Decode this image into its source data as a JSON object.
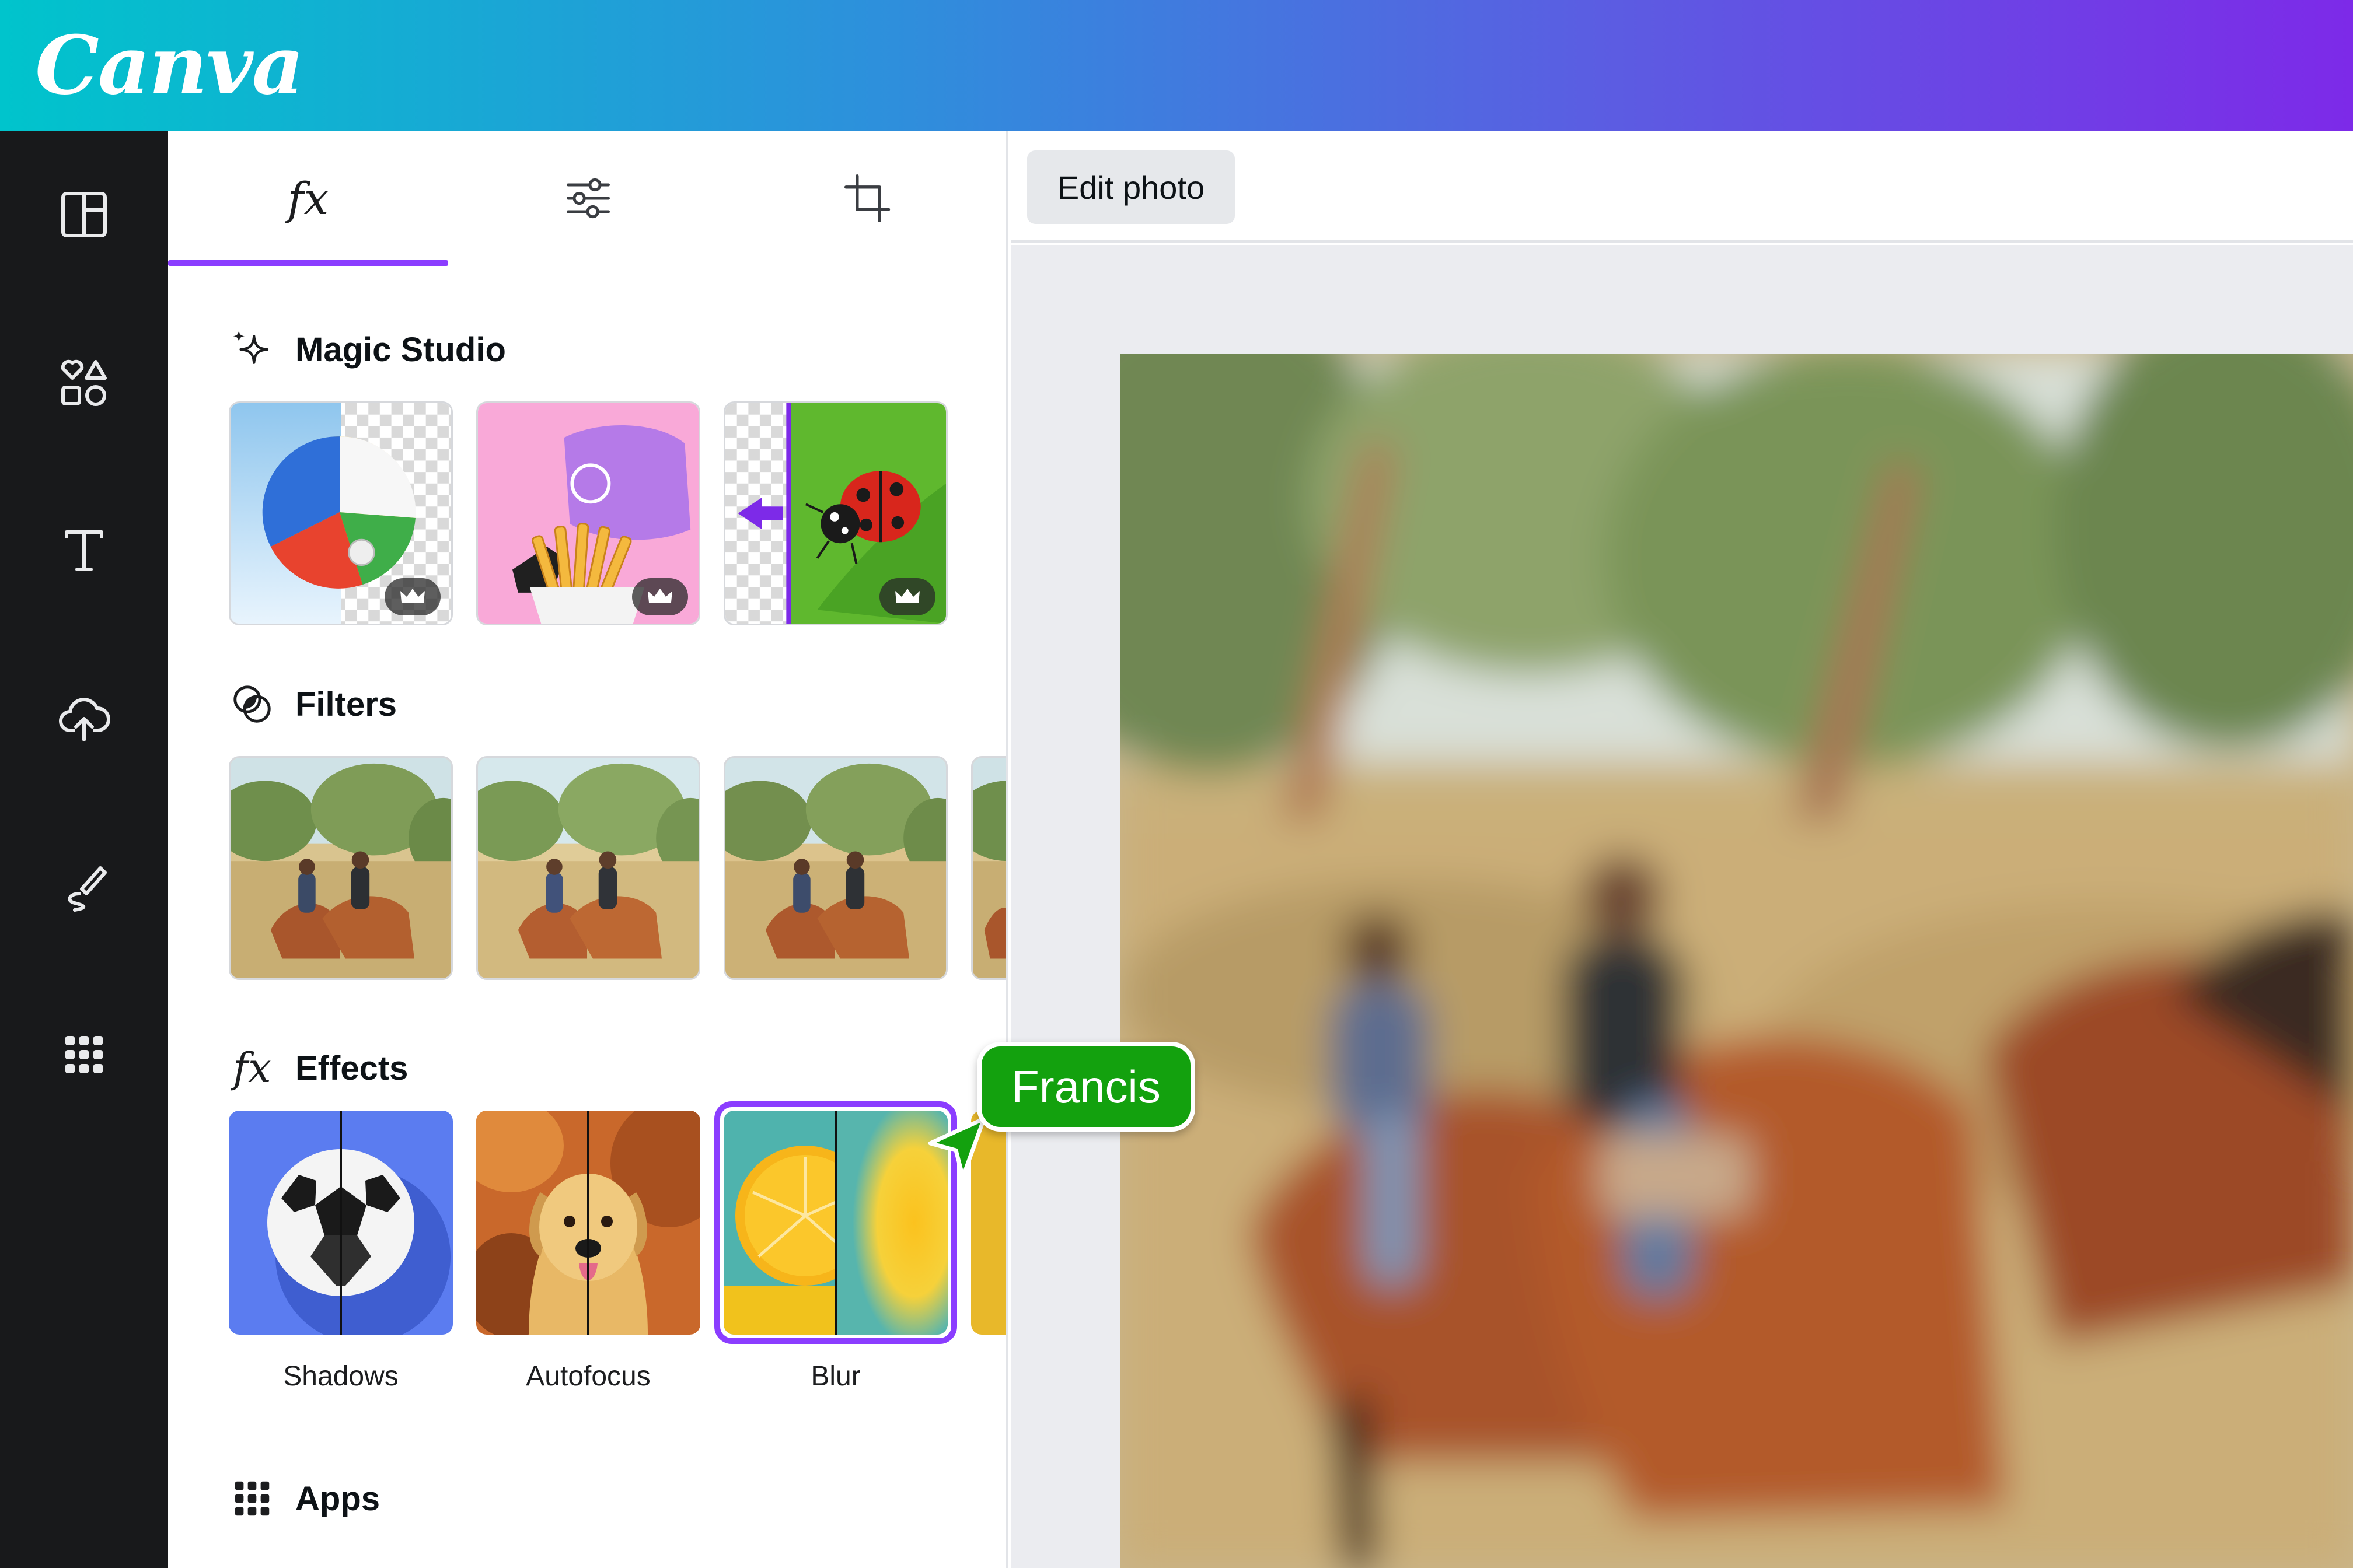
{
  "app": {
    "logo_text": "Canva",
    "brand_colors": {
      "teal": "#00c4cc",
      "purple": "#7d2ae8",
      "accent": "#8b3dff"
    }
  },
  "rail": {
    "items": [
      {
        "icon": "layout-icon"
      },
      {
        "icon": "elements-icon"
      },
      {
        "icon": "text-icon"
      },
      {
        "icon": "upload-icon"
      },
      {
        "icon": "draw-icon"
      },
      {
        "icon": "apps-grid-icon"
      }
    ]
  },
  "panel": {
    "tabs": [
      {
        "label": "fx",
        "icon": "effects-icon",
        "active": true
      },
      {
        "icon": "adjust-sliders-icon",
        "active": false
      },
      {
        "icon": "crop-icon",
        "active": false
      }
    ],
    "magic_studio": {
      "title": "Magic Studio",
      "icon": "sparkle-icon"
    },
    "filters": {
      "title": "Filters",
      "icon": "filters-icon"
    },
    "effects": {
      "title": "Effects",
      "icon_label": "fx",
      "items": [
        {
          "label": "Shadows"
        },
        {
          "label": "Autofocus"
        },
        {
          "label": "Blur",
          "selected": true
        }
      ]
    },
    "apps": {
      "title": "Apps",
      "icon": "apps-grid-icon"
    }
  },
  "toolbar": {
    "edit_photo_label": "Edit photo"
  },
  "collaborator": {
    "name": "Francis",
    "color": "#13a10e"
  }
}
